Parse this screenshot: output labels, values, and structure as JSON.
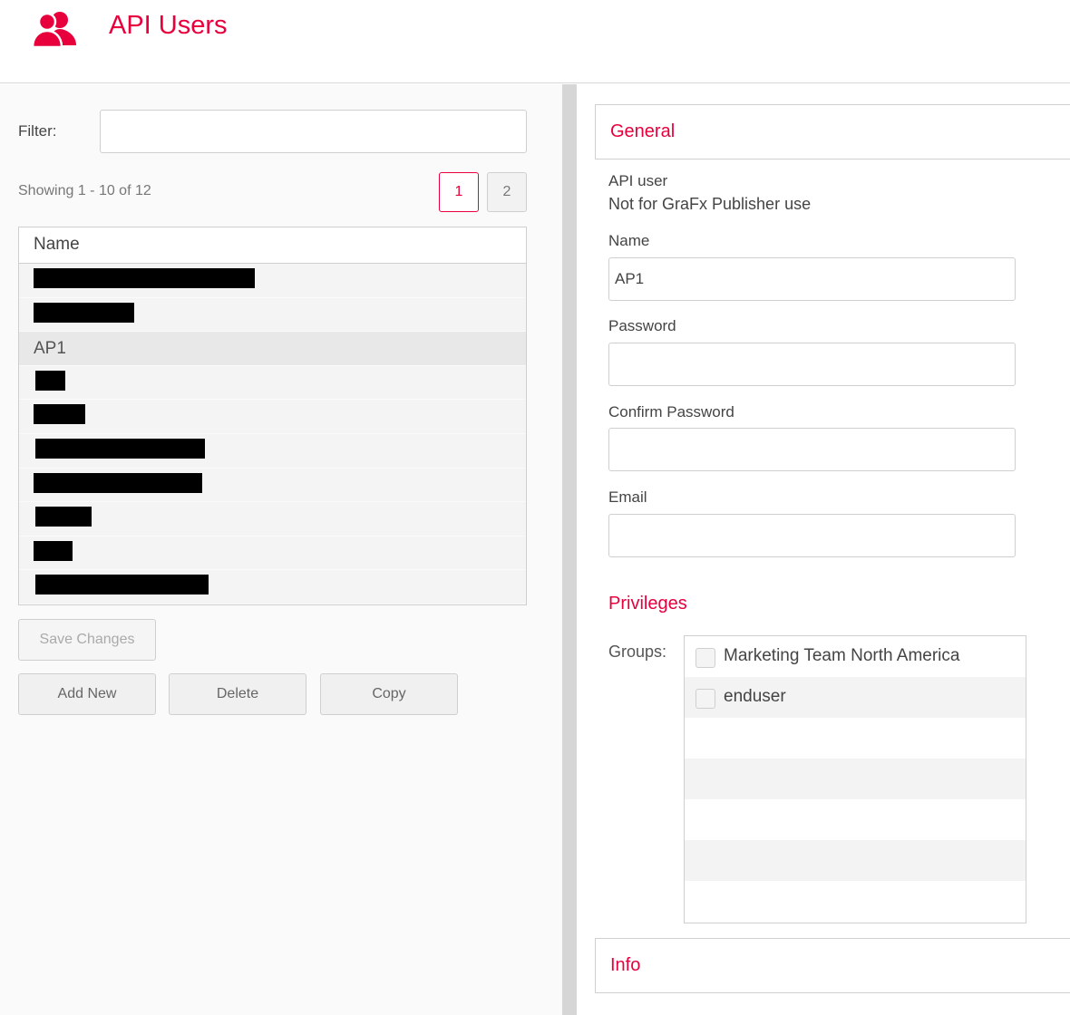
{
  "header": {
    "title": "API Users",
    "icon": "users-icon",
    "accent": "#e8003d"
  },
  "filter": {
    "label": "Filter:",
    "value": "",
    "placeholder": ""
  },
  "pagination": {
    "showing": "Showing 1 - 10 of 12",
    "pages": [
      "1",
      "2"
    ],
    "current": "1"
  },
  "table": {
    "header": "Name",
    "rows": [
      {
        "label": "",
        "redacted": true
      },
      {
        "label": "",
        "redacted": true
      },
      {
        "label": "AP1",
        "redacted": false,
        "selected": true
      },
      {
        "label": "",
        "redacted": true
      },
      {
        "label": "",
        "redacted": true
      },
      {
        "label": "",
        "redacted": true
      },
      {
        "label": "",
        "redacted": true
      },
      {
        "label": "",
        "redacted": true
      },
      {
        "label": "",
        "redacted": true
      },
      {
        "label": "",
        "redacted": true
      }
    ]
  },
  "buttons": {
    "save": "Save Changes",
    "add": "Add New",
    "delete": "Delete",
    "copy": "Copy"
  },
  "general": {
    "title": "General",
    "type_label": "API user",
    "type_note": "Not for GraFx Publisher use",
    "name_label": "Name",
    "name_value": "AP1",
    "password_label": "Password",
    "password_value": "",
    "confirm_label": "Confirm Password",
    "confirm_value": "",
    "email_label": "Email",
    "email_value": ""
  },
  "privileges": {
    "title": "Privileges",
    "groups_label": "Groups:",
    "groups": [
      {
        "label": "Marketing Team North America",
        "checked": false
      },
      {
        "label": "enduser",
        "checked": false
      }
    ]
  },
  "info": {
    "title": "Info"
  }
}
